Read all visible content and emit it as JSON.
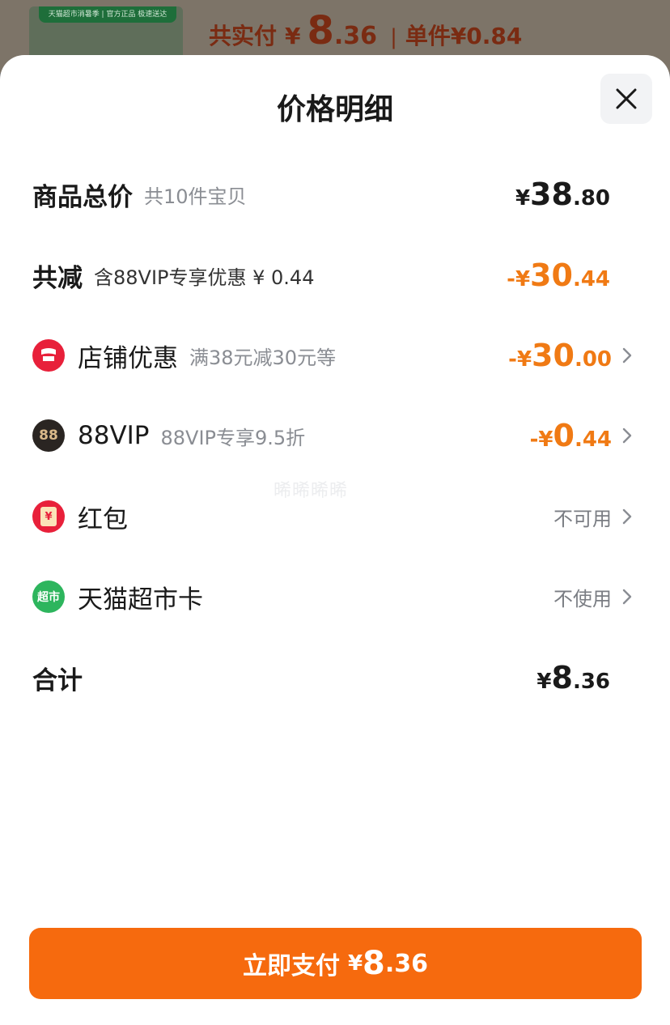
{
  "background": {
    "thumb_strip": "天猫超市消暑季 | 官方正品  极速送达",
    "paid_label": "共实付",
    "paid_currency": "¥",
    "paid_int": "8",
    "paid_dec": ".36",
    "separator": "|",
    "unit_price": "单件¥0.84"
  },
  "sheet": {
    "title": "价格明细",
    "close_icon": "close-icon"
  },
  "rows": {
    "total_goods": {
      "title": "商品总价",
      "sub": "共10件宝贝",
      "sign": "¥",
      "int": "38",
      "dec": ".80"
    },
    "total_discount": {
      "title": "共减",
      "sub": "含88VIP专享优惠 ¥ 0.44",
      "sign": "-¥",
      "int": "30",
      "dec": ".44"
    },
    "store_discount": {
      "icon": "store-icon",
      "title": "店铺优惠",
      "sub": "满38元减30元等",
      "sign": "-¥",
      "int": "30",
      "dec": ".00"
    },
    "vip88": {
      "icon": "88vip-icon",
      "icon_text": "88",
      "title": "88VIP",
      "sub": "88VIP专享9.5折",
      "sign": "-¥",
      "int": "0",
      "dec": ".44"
    },
    "red_packet": {
      "icon": "red-packet-icon",
      "icon_text": "¥",
      "title": "红包",
      "status": "不可用"
    },
    "market_card": {
      "icon": "tmall-supermarket-icon",
      "icon_text": "超市",
      "title": "天猫超市卡",
      "status": "不使用"
    },
    "grand_total": {
      "title": "合计",
      "sign": "¥",
      "int": "8",
      "dec": ".36"
    }
  },
  "watermark": "晞晞晞晞",
  "pay_button": {
    "label": "立即支付",
    "sign": "¥",
    "int": "8",
    "dec": ".36"
  },
  "colors": {
    "accent_orange": "#f07a14",
    "pay_button": "#f66a0e",
    "store_icon_red": "#e8203a",
    "vip_icon_dark": "#2a2522",
    "market_icon_green": "#2db55d"
  }
}
